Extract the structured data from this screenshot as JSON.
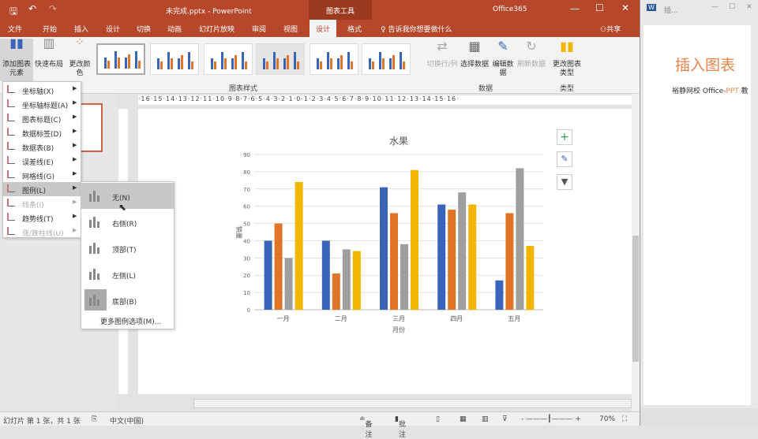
{
  "titlebar": {
    "doc_title": "未完成.pptx - PowerPoint",
    "context_tab": "图表工具",
    "account": "Office365"
  },
  "tabs": [
    "文件",
    "开始",
    "插入",
    "设计",
    "切换",
    "动画",
    "幻灯片放映",
    "审阅",
    "视图",
    "设计",
    "格式"
  ],
  "active_tab_index": 9,
  "tell_me": "告诉我你想要做什么",
  "share": "共享",
  "ribbon": {
    "add_element": "添加图表元素",
    "quick_layout": "快速布局",
    "change_colors": "更改颜色",
    "styles_group": "图表样式",
    "switch_row_col": "切换行/列",
    "select_data": "选择数据",
    "edit_data": "编辑数据",
    "refresh_data": "刷新数据",
    "data_group": "数据",
    "change_type": "更改图表类型",
    "type_group": "类型"
  },
  "menu": {
    "items": [
      {
        "label": "坐标轴(X)",
        "enabled": true
      },
      {
        "label": "坐标轴标题(A)",
        "enabled": true
      },
      {
        "label": "图表标题(C)",
        "enabled": true
      },
      {
        "label": "数据标签(D)",
        "enabled": true
      },
      {
        "label": "数据表(B)",
        "enabled": true
      },
      {
        "label": "误差线(E)",
        "enabled": true
      },
      {
        "label": "网格线(G)",
        "enabled": true
      },
      {
        "label": "图例(L)",
        "enabled": true,
        "selected": true
      },
      {
        "label": "线条(I)",
        "enabled": false
      },
      {
        "label": "趋势线(T)",
        "enabled": true
      },
      {
        "label": "涨/跌柱线(U)",
        "enabled": false
      }
    ]
  },
  "submenu": {
    "items": [
      {
        "label": "无(N)",
        "selected": true
      },
      {
        "label": "右侧(R)"
      },
      {
        "label": "顶部(T)"
      },
      {
        "label": "左侧(L)"
      },
      {
        "label": "底部(B)"
      }
    ],
    "more": "更多图例选项(M)..."
  },
  "ruler": "·16·15·14·13·12·11·10·9·8·7·6·5·4·3·2·1·0·1·2·3·4·5·6·7·8·9·10·11·12·13·14·15·16·",
  "chart_data": {
    "type": "bar",
    "title": "水果",
    "xlabel": "月份",
    "ylabel": "销量",
    "categories": [
      "一月",
      "二月",
      "三月",
      "四月",
      "五月"
    ],
    "series": [
      {
        "color": "#3a64b8",
        "values": [
          40,
          40,
          71,
          61,
          17
        ]
      },
      {
        "color": "#e07427",
        "values": [
          50,
          21,
          56,
          58,
          56
        ]
      },
      {
        "color": "#9e9e9e",
        "values": [
          30,
          35,
          38,
          68,
          82
        ]
      },
      {
        "color": "#f2b600",
        "values": [
          74,
          34,
          81,
          61,
          37
        ]
      }
    ],
    "ylim": [
      0,
      90
    ],
    "yticks": [
      0,
      10,
      20,
      30,
      40,
      50,
      60,
      70,
      80,
      90
    ],
    "grid": true,
    "legend": "none"
  },
  "status": {
    "slide": "幻灯片 第 1 张，共 1 张",
    "lang": "中文(中国)",
    "notes": "备注",
    "comments": "批注",
    "zoom": "70%"
  },
  "word": {
    "title": "插...",
    "heading": "插入图表",
    "text_a": "裕静网校 Office-",
    "text_b": "PPT",
    "text_c": " 教"
  },
  "colors": {
    "accent": "#b7472a"
  }
}
